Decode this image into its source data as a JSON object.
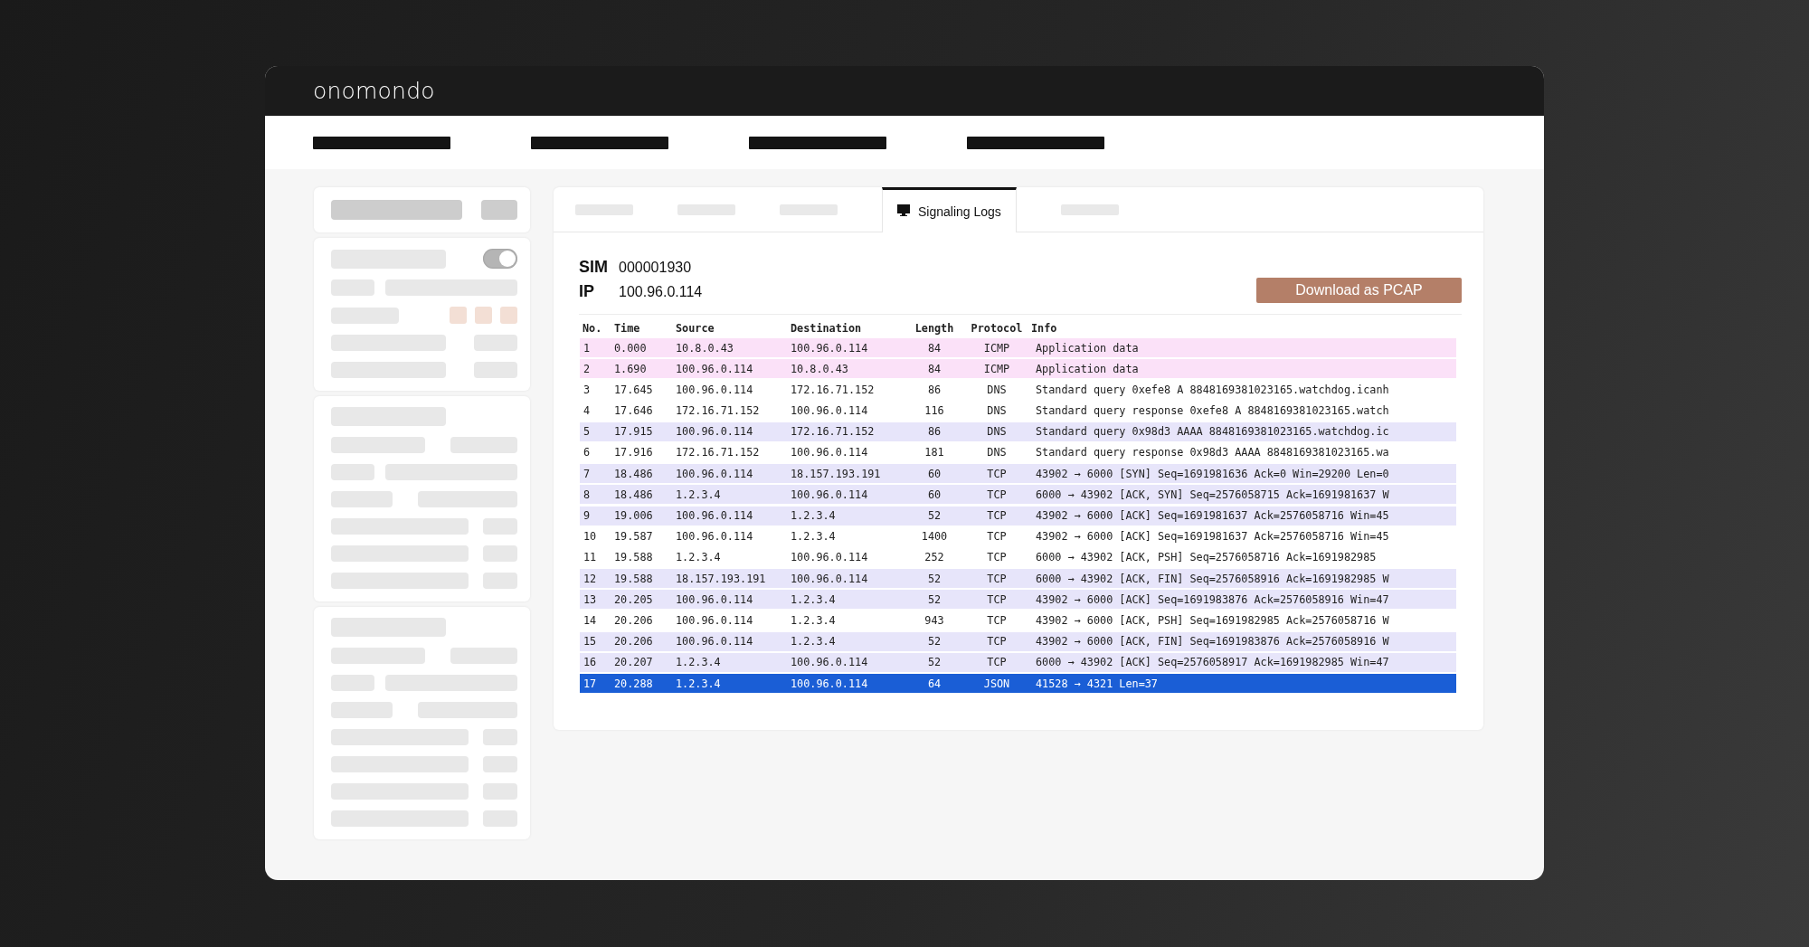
{
  "header": {
    "logo": "onomondo"
  },
  "sidebar": {
    "toggle": {
      "on": true
    }
  },
  "tabs": [
    {
      "kind": "placeholder",
      "selected": false
    },
    {
      "kind": "placeholder",
      "selected": false
    },
    {
      "kind": "placeholder",
      "selected": false
    },
    {
      "kind": "label",
      "label": "Signaling Logs",
      "selected": true
    },
    {
      "kind": "placeholder",
      "selected": false
    }
  ],
  "details": [
    {
      "label": "SIM",
      "value": "000001930"
    },
    {
      "label": "IP",
      "value": "100.96.0.114"
    }
  ],
  "download_button": "Download as PCAP",
  "table": {
    "columns": [
      "No.",
      "Time",
      "Source",
      "Destination",
      "Length",
      "Protocol",
      "Info"
    ],
    "rows": [
      {
        "cells": [
          "1",
          "0.000",
          "10.8.0.43",
          "100.96.0.114",
          "84",
          "ICMP",
          "Application data"
        ],
        "color": "#fbe1f8",
        "selected": false
      },
      {
        "cells": [
          "2",
          "1.690",
          "100.96.0.114",
          "10.8.0.43",
          "84",
          "ICMP",
          "Application data"
        ],
        "color": "#fbe1f8",
        "selected": false
      },
      {
        "cells": [
          "3",
          "17.645",
          "100.96.0.114",
          "172.16.71.152",
          "86",
          "DNS",
          "Standard query 0xefe8 A 8848169381023165.watchdog.icanh"
        ],
        "color": "#ffffff",
        "selected": false
      },
      {
        "cells": [
          "4",
          "17.646",
          "172.16.71.152",
          "100.96.0.114",
          "116",
          "DNS",
          "Standard query response 0xefe8 A 8848169381023165.watch"
        ],
        "color": "#ffffff",
        "selected": false
      },
      {
        "cells": [
          "5",
          "17.915",
          "100.96.0.114",
          "172.16.71.152",
          "86",
          "DNS",
          "Standard query 0x98d3 AAAA 8848169381023165.watchdog.ic"
        ],
        "color": "#e7e5fa",
        "selected": false
      },
      {
        "cells": [
          "6",
          "17.916",
          "172.16.71.152",
          "100.96.0.114",
          "181",
          "DNS",
          "Standard query response 0x98d3 AAAA 8848169381023165.wa"
        ],
        "color": "#ffffff",
        "selected": false
      },
      {
        "cells": [
          "7",
          "18.486",
          "100.96.0.114",
          "18.157.193.191",
          "60",
          "TCP",
          "43902 → 6000 [SYN] Seq=1691981636 Ack=0 Win=29200 Len=0"
        ],
        "color": "#e7e5fa",
        "selected": false
      },
      {
        "cells": [
          "8",
          "18.486",
          "1.2.3.4",
          "100.96.0.114",
          "60",
          "TCP",
          "6000 → 43902 [ACK, SYN] Seq=2576058715 Ack=1691981637 W"
        ],
        "color": "#e7e5fa",
        "selected": false
      },
      {
        "cells": [
          "9",
          "19.006",
          "100.96.0.114",
          "1.2.3.4",
          "52",
          "TCP",
          "43902 → 6000 [ACK] Seq=1691981637 Ack=2576058716 Win=45"
        ],
        "color": "#e7e5fa",
        "selected": false
      },
      {
        "cells": [
          "10",
          "19.587",
          "100.96.0.114",
          "1.2.3.4",
          "1400",
          "TCP",
          "43902 → 6000 [ACK] Seq=1691981637 Ack=2576058716 Win=45"
        ],
        "color": "#ffffff",
        "selected": false
      },
      {
        "cells": [
          "11",
          "19.588",
          "1.2.3.4",
          "100.96.0.114",
          "252",
          "TCP",
          "6000 → 43902 [ACK, PSH] Seq=2576058716 Ack=1691982985"
        ],
        "color": "#ffffff",
        "selected": false
      },
      {
        "cells": [
          "12",
          "19.588",
          "18.157.193.191",
          "100.96.0.114",
          "52",
          "TCP",
          "6000 → 43902 [ACK, FIN] Seq=2576058916 Ack=1691982985 W"
        ],
        "color": "#e7e5fa",
        "selected": false
      },
      {
        "cells": [
          "13",
          "20.205",
          "100.96.0.114",
          "1.2.3.4",
          "52",
          "TCP",
          "43902 → 6000 [ACK] Seq=1691983876 Ack=2576058916 Win=47"
        ],
        "color": "#e7e5fa",
        "selected": false
      },
      {
        "cells": [
          "14",
          "20.206",
          "100.96.0.114",
          "1.2.3.4",
          "943",
          "TCP",
          "43902 → 6000 [ACK, PSH] Seq=1691982985 Ack=2576058716 W"
        ],
        "color": "#ffffff",
        "selected": false
      },
      {
        "cells": [
          "15",
          "20.206",
          "100.96.0.114",
          "1.2.3.4",
          "52",
          "TCP",
          "43902 → 6000 [ACK, FIN] Seq=1691983876 Ack=2576058916 W"
        ],
        "color": "#e7e5fa",
        "selected": false
      },
      {
        "cells": [
          "16",
          "20.207",
          "1.2.3.4",
          "100.96.0.114",
          "52",
          "TCP",
          "6000 → 43902 [ACK] Seq=2576058917 Ack=1691982985 Win=47"
        ],
        "color": "#e7e5fa",
        "selected": false
      },
      {
        "cells": [
          "17",
          "20.288",
          "1.2.3.4",
          "100.96.0.114",
          "64",
          "JSON",
          "41528 → 4321 Len=37"
        ],
        "selected": true
      }
    ]
  }
}
